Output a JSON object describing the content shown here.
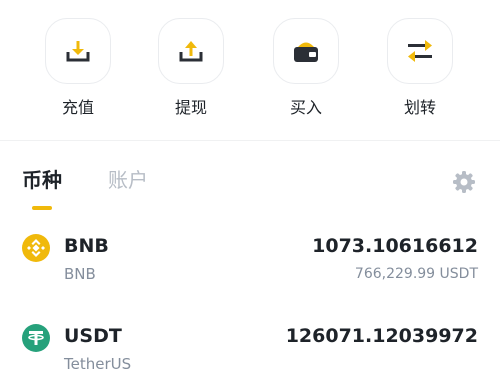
{
  "actions": [
    {
      "label": "充值",
      "icon": "deposit-icon"
    },
    {
      "label": "提现",
      "icon": "withdraw-icon"
    },
    {
      "label": "买入",
      "icon": "wallet-icon"
    },
    {
      "label": "划转",
      "icon": "transfer-icon"
    }
  ],
  "tabs": {
    "coins": "币种",
    "accounts": "账户",
    "active": "coins"
  },
  "assets": [
    {
      "symbol": "BNB",
      "name": "BNB",
      "amount": "1073.10616612",
      "fiat_value": "766,229.99 USDT",
      "icon": "bnb-coin-icon",
      "icon_color": "#f0b90b"
    },
    {
      "symbol": "USDT",
      "name": "TetherUS",
      "amount": "126071.12039972",
      "icon": "usdt-coin-icon",
      "icon_color": "#26a17b"
    }
  ],
  "colors": {
    "accent": "#f0b90b",
    "text_primary": "#1e2329",
    "text_secondary": "#848e9c",
    "icon_dark": "#2b2f36"
  }
}
